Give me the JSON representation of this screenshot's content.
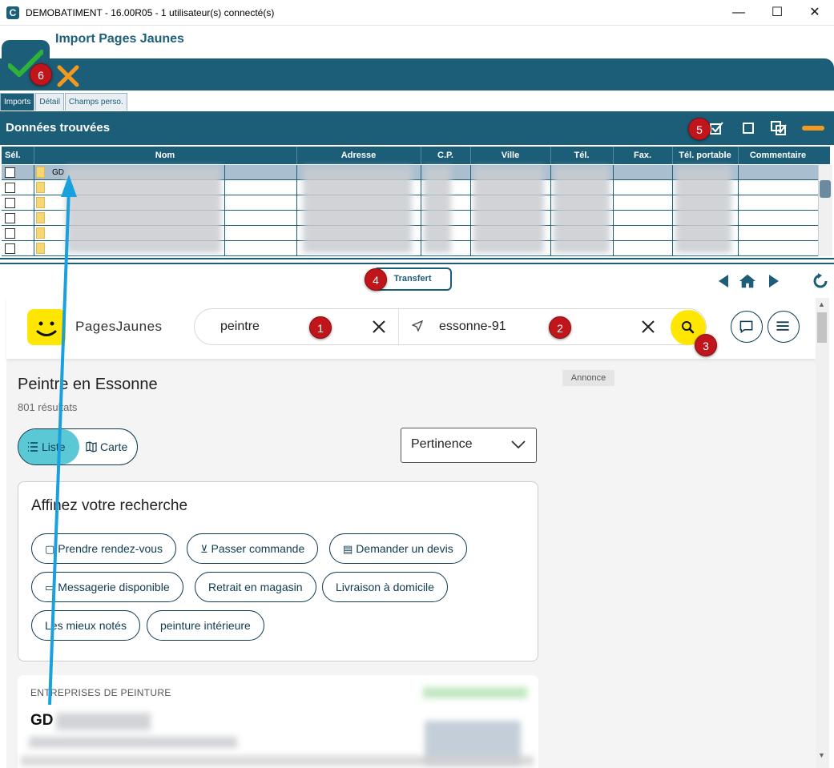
{
  "window": {
    "title": "DEMOBATIMENT - 16.00R05 - 1 utilisateur(s) connecté(s)",
    "minimize": "—",
    "maximize": "☐",
    "close": "✕"
  },
  "module": {
    "title": "Import Pages Jaunes"
  },
  "tabs": [
    {
      "label": "Imports"
    },
    {
      "label": "Détail"
    },
    {
      "label": "Champs perso."
    }
  ],
  "panel": {
    "title": "Données trouvées"
  },
  "grid": {
    "columns": [
      "Sél.",
      "Nom",
      "Adresse",
      "C.P.",
      "Ville",
      "Tél.",
      "Fax.",
      "Tél. portable",
      "Commentaire"
    ],
    "first_row_name": "GD"
  },
  "transfer": {
    "label": "Transfert"
  },
  "badges": [
    "1",
    "2",
    "3",
    "4",
    "5",
    "6"
  ],
  "web": {
    "brand": "PagesJaunes",
    "what_value": "peintre",
    "where_value": "essonne-91",
    "main_title": "Peintre en Essonne",
    "results": "801 résultats",
    "view_list": "Liste",
    "view_map": "Carte",
    "sort": "Pertinence",
    "annonce": "Annonce",
    "refine_title": "Affinez votre recherche",
    "chips": [
      "Prendre rendez-vous",
      "Passer commande",
      "Demander un devis",
      "Messagerie disponible",
      "Retrait en magasin",
      "Livraison à domicile",
      "Les mieux notés",
      "peinture intérieure"
    ],
    "company_category": "ENTREPRISES DE PEINTURE",
    "company_name": "GD"
  },
  "colors": {
    "brand_dark": "#1c5d78",
    "pj_yellow": "#ffe600",
    "badge_red": "#c0151b",
    "arrow_blue": "#1aa0dc",
    "liste_active": "#5bc8d6"
  }
}
